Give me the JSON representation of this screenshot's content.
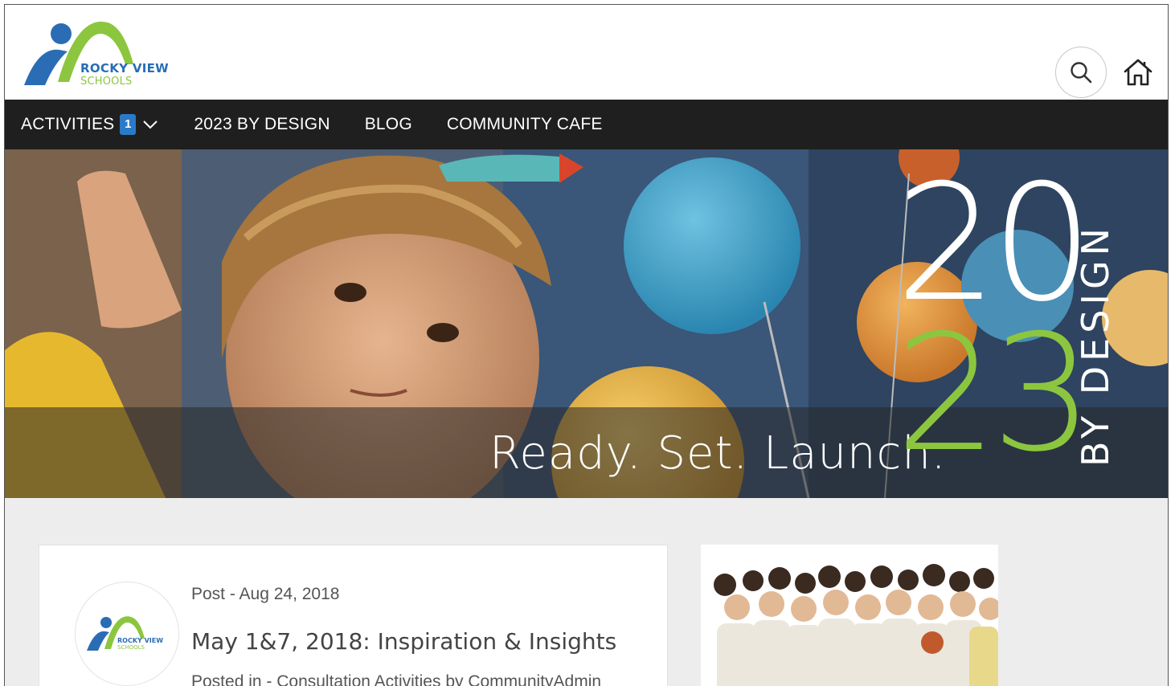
{
  "header": {
    "logo": {
      "line1": "ROCKY VIEW",
      "line2": "SCHOOLS"
    },
    "search_icon": "search-icon",
    "home_icon": "home-icon"
  },
  "nav": {
    "items": [
      {
        "label": "ACTIVITIES",
        "badge": "1",
        "has_dropdown": true
      },
      {
        "label": "2023 BY DESIGN"
      },
      {
        "label": "BLOG"
      },
      {
        "label": "COMMUNITY CAFE"
      }
    ]
  },
  "hero": {
    "tagline": "Ready. Set. Launch.",
    "year_top": "20",
    "year_bottom": "23",
    "side_text": "BY DESIGN",
    "accent_color": "#8cc63f"
  },
  "post": {
    "meta": "Post - Aug 24, 2018",
    "title": "May 1&7, 2018: Inspiration & Insights",
    "posted_in": "Posted in - Consultation Activities by CommunityAdmin",
    "avatar_logo": {
      "line1": "ROCKY VIEW",
      "line2": "SCHOOLS"
    }
  },
  "colors": {
    "nav_bg": "#1f1f1f",
    "badge_bg": "#2a7ac8",
    "brand_blue": "#2a6db5",
    "brand_green": "#8cc63f",
    "content_bg": "#ededed"
  }
}
